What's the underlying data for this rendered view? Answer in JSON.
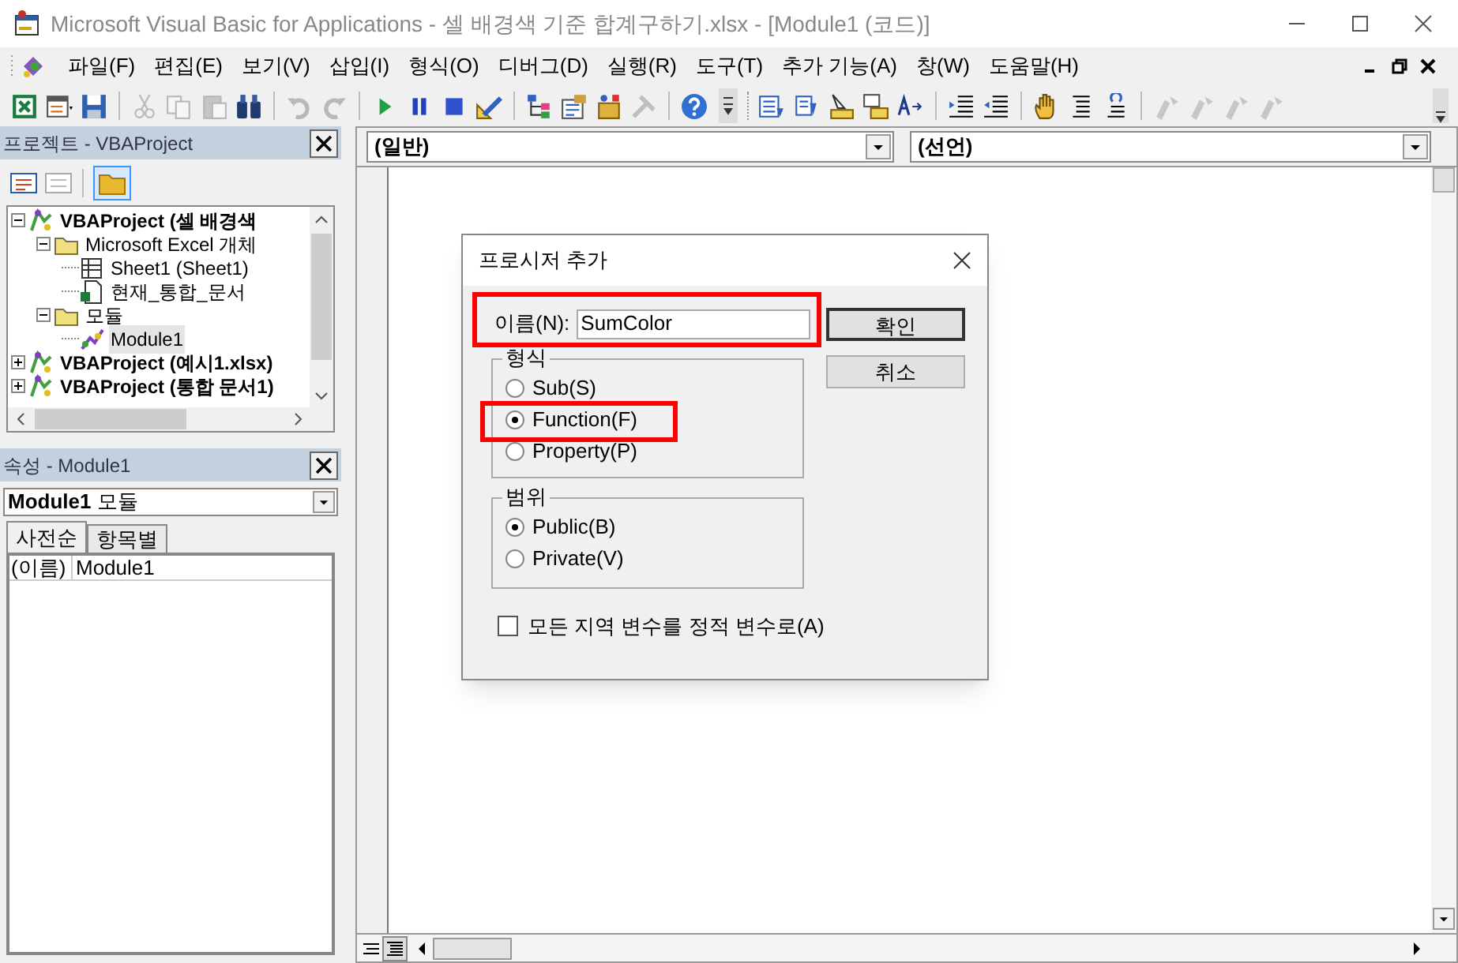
{
  "window": {
    "title": "Microsoft Visual Basic for Applications - 셀 배경색 기준 합계구하기.xlsx - [Module1 (코드)]"
  },
  "menu": [
    "파일(F)",
    "편집(E)",
    "보기(V)",
    "삽입(I)",
    "형식(O)",
    "디버그(D)",
    "실행(R)",
    "도구(T)",
    "추가 기능(A)",
    "창(W)",
    "도움말(H)"
  ],
  "toolbar": [
    {
      "kind": "excel",
      "disabled": false
    },
    {
      "kind": "form",
      "disabled": false
    },
    {
      "kind": "save",
      "disabled": false
    },
    {
      "kind": "separator"
    },
    {
      "kind": "cut",
      "disabled": true
    },
    {
      "kind": "copy",
      "disabled": true
    },
    {
      "kind": "paste",
      "disabled": true
    },
    {
      "kind": "find",
      "disabled": false
    },
    {
      "kind": "separator"
    },
    {
      "kind": "undo",
      "disabled": true
    },
    {
      "kind": "redo",
      "disabled": true
    },
    {
      "kind": "separator"
    },
    {
      "kind": "run",
      "disabled": false
    },
    {
      "kind": "pause",
      "disabled": false
    },
    {
      "kind": "stop",
      "disabled": false
    },
    {
      "kind": "design",
      "disabled": false
    },
    {
      "kind": "separator"
    },
    {
      "kind": "project",
      "disabled": false
    },
    {
      "kind": "properties",
      "disabled": false
    },
    {
      "kind": "browser",
      "disabled": false
    },
    {
      "kind": "toolbox",
      "disabled": true
    },
    {
      "kind": "separator"
    },
    {
      "kind": "help",
      "disabled": false
    },
    {
      "kind": "grip"
    },
    {
      "kind": "members",
      "disabled": false
    },
    {
      "kind": "constants",
      "disabled": false
    },
    {
      "kind": "info",
      "disabled": false
    },
    {
      "kind": "params",
      "disabled": false
    },
    {
      "kind": "complete",
      "disabled": false
    },
    {
      "kind": "separator"
    },
    {
      "kind": "indent",
      "disabled": false
    },
    {
      "kind": "outdent",
      "disabled": false
    },
    {
      "kind": "separator"
    },
    {
      "kind": "breakpoint",
      "disabled": false
    },
    {
      "kind": "comment",
      "disabled": false
    },
    {
      "kind": "uncomment",
      "disabled": false
    },
    {
      "kind": "separator"
    },
    {
      "kind": "bookmark",
      "disabled": true
    },
    {
      "kind": "bookmark",
      "disabled": true
    },
    {
      "kind": "bookmark",
      "disabled": true
    },
    {
      "kind": "bookmark",
      "disabled": true
    }
  ],
  "project_panel": {
    "title": "프로젝트 - VBAProject",
    "tree": [
      {
        "label": "VBAProject (셀 배경색",
        "kind": "project",
        "expanded": true,
        "selected": false,
        "children": [
          {
            "label": "Microsoft Excel 개체",
            "kind": "folder",
            "expanded": true,
            "selected": false,
            "children": [
              {
                "label": "Sheet1 (Sheet1)",
                "kind": "sheet",
                "selected": false
              },
              {
                "label": "현재_통합_문서",
                "kind": "workbook",
                "selected": false
              }
            ]
          },
          {
            "label": "모듈",
            "kind": "folder",
            "expanded": true,
            "selected": false,
            "children": [
              {
                "label": "Module1",
                "kind": "module",
                "selected": true
              }
            ]
          }
        ]
      },
      {
        "label": "VBAProject (예시1.xlsx)",
        "kind": "project",
        "expanded": false,
        "selected": false
      },
      {
        "label": "VBAProject (통합 문서1)",
        "kind": "project",
        "expanded": false,
        "selected": false
      }
    ]
  },
  "properties_panel": {
    "title": "속성 - Module1",
    "object": "**Module1** 모듈",
    "tabs": [
      {
        "label": "사전순",
        "selected": true
      },
      {
        "label": "항목별",
        "selected": false
      }
    ],
    "rows": [
      {
        "name": "(이름)",
        "value": "Module1"
      }
    ]
  },
  "code_window": {
    "object_combo": "(일반)",
    "procedure_combo": "(선언)"
  },
  "dialog": {
    "title": "프로시저 추가",
    "name_label": "이름(N):",
    "name_value": "SumColor",
    "buttons": [
      "확인",
      "취소"
    ],
    "type_group": {
      "label": "형식",
      "options": [
        {
          "label": "Sub(S)",
          "selected": false
        },
        {
          "label": "Function(F)",
          "selected": true
        },
        {
          "label": "Property(P)",
          "selected": false
        }
      ]
    },
    "scope_group": {
      "label": "범위",
      "options": [
        {
          "label": "Public(B)",
          "selected": true
        },
        {
          "label": "Private(V)",
          "selected": false
        }
      ]
    },
    "static_checkbox": {
      "label": "모든 지역 변수를 정적 변수로(A)",
      "checked": false
    }
  }
}
